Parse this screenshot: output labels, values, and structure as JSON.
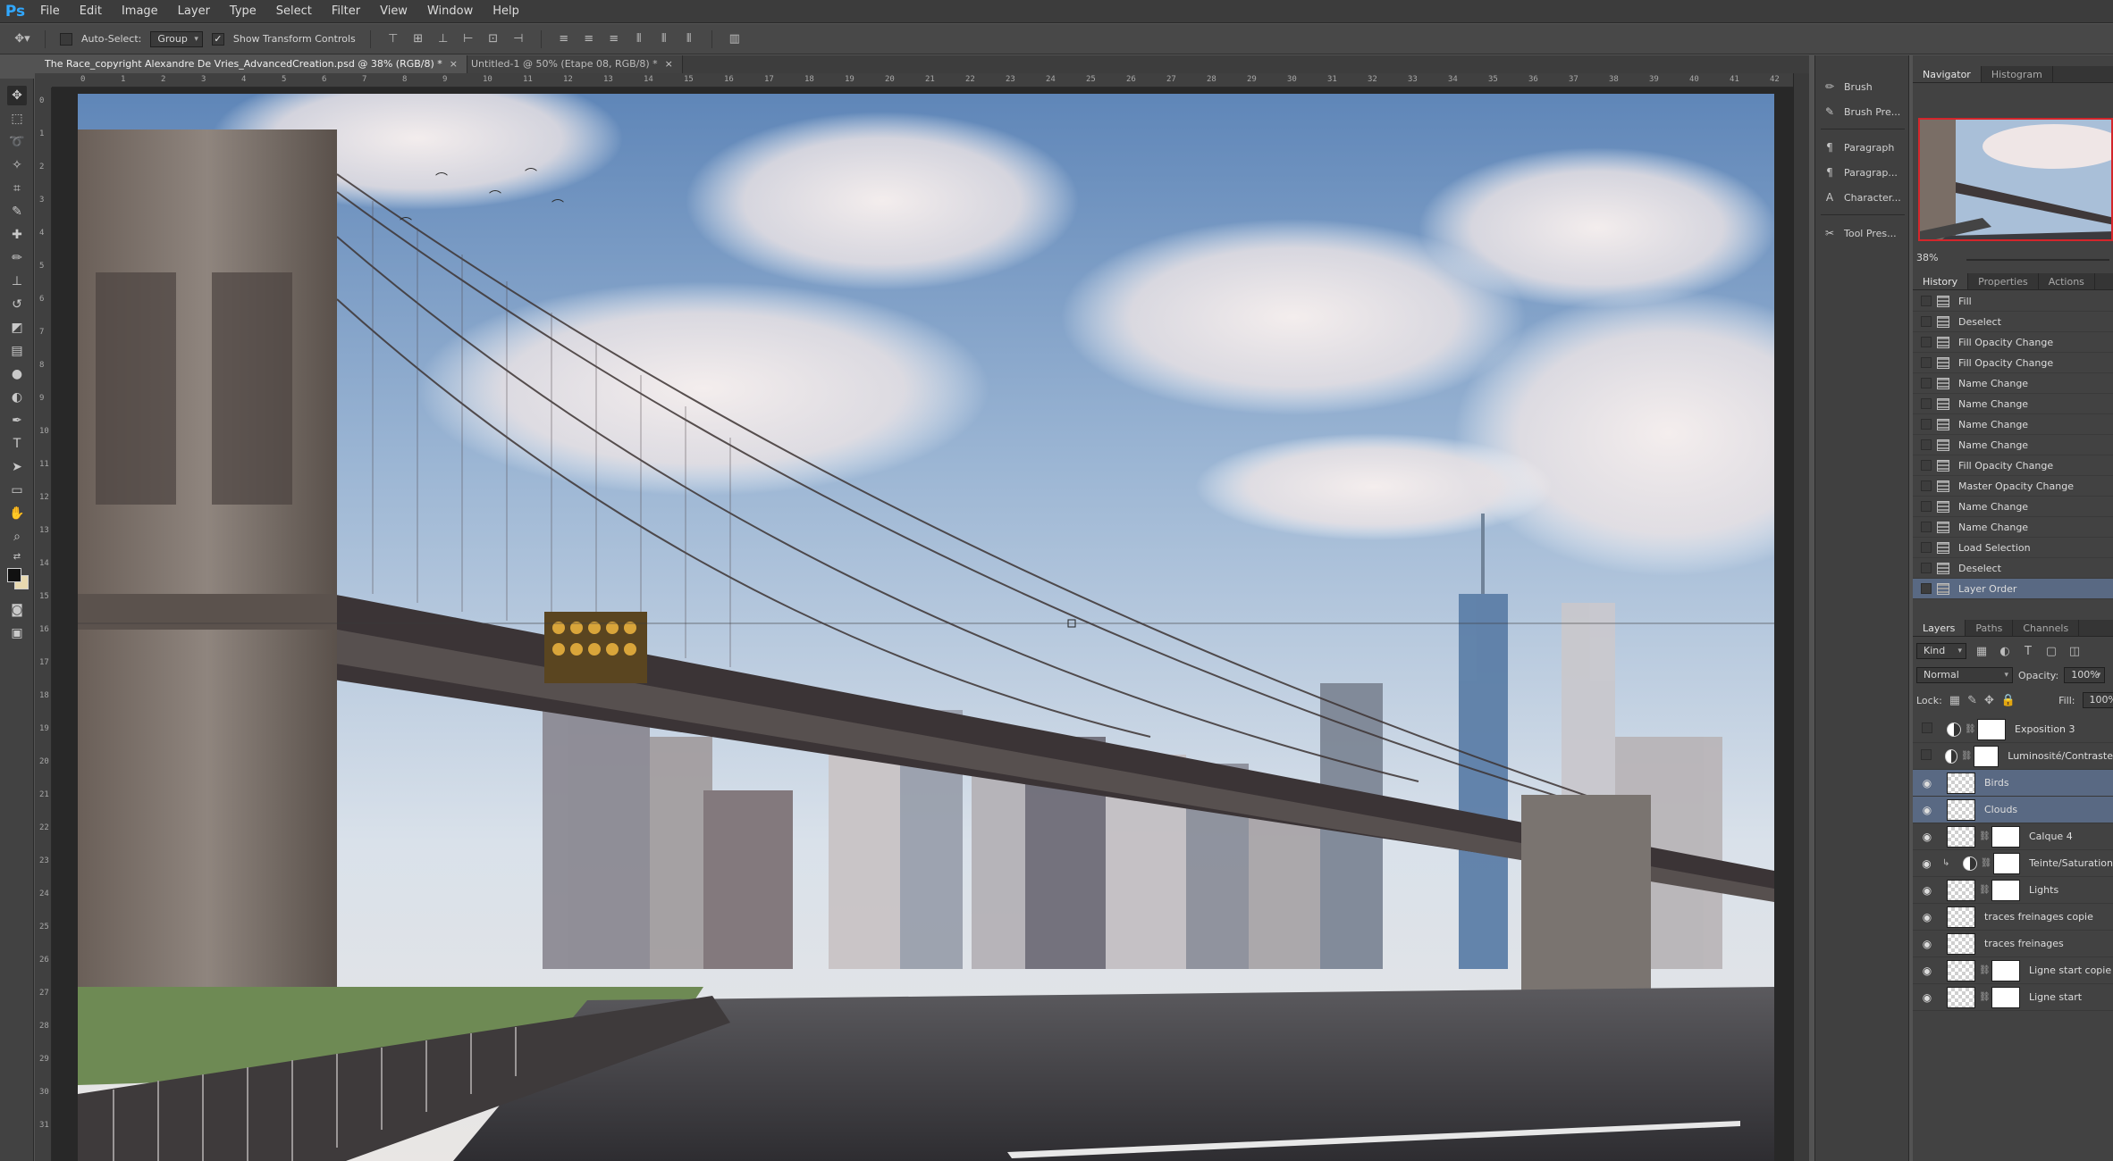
{
  "app": {
    "logo": "Ps",
    "menu": [
      "File",
      "Edit",
      "Image",
      "Layer",
      "Type",
      "Select",
      "Filter",
      "View",
      "Window",
      "Help"
    ]
  },
  "options_bar": {
    "auto_select_label": "Auto-Select:",
    "auto_select_value": "Group",
    "show_transform_label": "Show Transform Controls",
    "show_transform_checked": "✓"
  },
  "tabs": [
    {
      "label": "The Race_copyright Alexandre De Vries_AdvancedCreation.psd @ 38% (RGB/8) *",
      "close": "×"
    },
    {
      "label": "Untitled-1 @ 50% (Etape 08, RGB/8) *",
      "close": "×"
    }
  ],
  "ruler": {
    "h_ticks": [
      "0",
      "1",
      "2",
      "3",
      "4",
      "5",
      "6",
      "7",
      "8",
      "9",
      "10",
      "11",
      "12",
      "13",
      "14",
      "15",
      "16",
      "17",
      "18",
      "19",
      "20",
      "21",
      "22",
      "23",
      "24",
      "25",
      "26",
      "27",
      "28",
      "29",
      "30",
      "31",
      "32",
      "33",
      "34",
      "35",
      "36",
      "37",
      "38",
      "39",
      "40",
      "41",
      "42"
    ],
    "v_ticks": [
      "0",
      "1",
      "2",
      "3",
      "4",
      "5",
      "6",
      "7",
      "8",
      "9",
      "10",
      "11",
      "12",
      "13",
      "14",
      "15",
      "16",
      "17",
      "18",
      "19",
      "20",
      "21",
      "22",
      "23",
      "24",
      "25",
      "26",
      "27",
      "28",
      "29",
      "30",
      "31"
    ]
  },
  "collapsed_panels": {
    "group1": [
      "Brush",
      "Brush Pre..."
    ],
    "group2": [
      "Paragraph",
      "Paragrap...",
      "Character..."
    ],
    "group3": [
      "Tool Pres..."
    ]
  },
  "navigator": {
    "tabs": [
      "Navigator",
      "Histogram"
    ],
    "zoom": "38%"
  },
  "history": {
    "tabs": [
      "History",
      "Properties",
      "Actions"
    ],
    "items": [
      "Fill",
      "Deselect",
      "Fill Opacity Change",
      "Fill Opacity Change",
      "Name Change",
      "Name Change",
      "Name Change",
      "Name Change",
      "Fill Opacity Change",
      "Master Opacity Change",
      "Name Change",
      "Name Change",
      "Load Selection",
      "Deselect",
      "Layer Order"
    ]
  },
  "layers": {
    "tabs": [
      "Layers",
      "Paths",
      "Channels"
    ],
    "filter_kind": "Kind",
    "blend_mode": "Normal",
    "opacity_label": "Opacity:",
    "opacity_value": "100%",
    "lock_label": "Lock:",
    "fill_label": "Fill:",
    "fill_value": "100%",
    "items": [
      {
        "name": "Exposition 3"
      },
      {
        "name": "Luminosité/Contraste"
      },
      {
        "name": "Birds"
      },
      {
        "name": "Clouds"
      },
      {
        "name": "Calque 4"
      },
      {
        "name": "Teinte/Saturation"
      },
      {
        "name": "Lights"
      },
      {
        "name": "traces freinages copie"
      },
      {
        "name": "traces freinages"
      },
      {
        "name": "Ligne start copie"
      },
      {
        "name": "Ligne start"
      }
    ]
  }
}
